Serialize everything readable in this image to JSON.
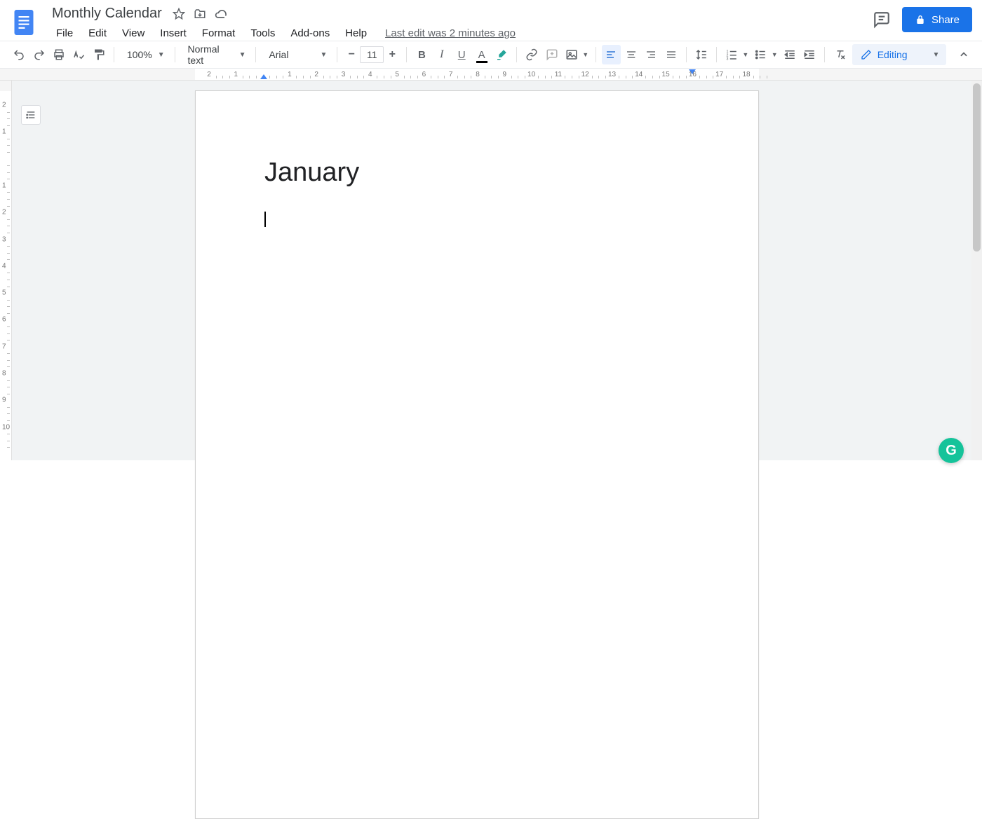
{
  "doc": {
    "title": "Monthly Calendar",
    "last_edit": "Last edit was 2 minutes ago"
  },
  "menubar": {
    "items": [
      "File",
      "Edit",
      "View",
      "Insert",
      "Format",
      "Tools",
      "Add-ons",
      "Help"
    ]
  },
  "toolbar": {
    "zoom": "100%",
    "paragraph_style": "Normal text",
    "font": "Arial",
    "font_size": "11",
    "editing_mode": "Editing"
  },
  "share": {
    "label": "Share"
  },
  "ruler_h": {
    "ticks": [
      "2",
      "1",
      "",
      "1",
      "2",
      "3",
      "4",
      "5",
      "6",
      "7",
      "8",
      "9",
      "10",
      "11",
      "12",
      "13",
      "14",
      "15",
      "16",
      "17",
      "18"
    ]
  },
  "ruler_v": {
    "ticks": [
      "2",
      "1",
      "",
      "1",
      "2",
      "3",
      "4",
      "5",
      "6",
      "7",
      "8",
      "9",
      "10"
    ]
  },
  "document_body": {
    "heading": "January"
  },
  "colors": {
    "primary": "#1a73e8"
  }
}
